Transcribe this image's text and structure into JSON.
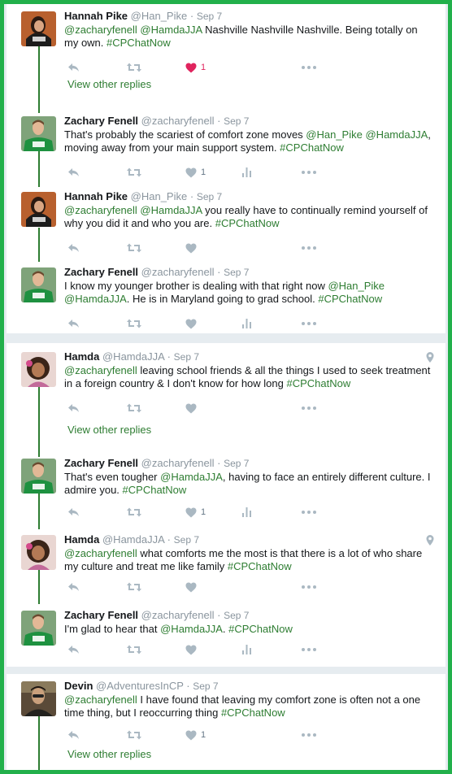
{
  "colors": {
    "accent": "#2e7d32",
    "like": "#e0245e",
    "frame": "#22b04b",
    "muted": "#8a959e"
  },
  "sep": "·",
  "groups": [
    {
      "tweets": [
        {
          "name": "Hannah Pike",
          "handle": "@Han_Pike",
          "time": "Sep 7",
          "segments": [
            [
              "@zacharyfenell",
              1
            ],
            [
              " ",
              0
            ],
            [
              "@HamdaJJA",
              1
            ],
            [
              " Nashville Nashville Nashville. Being totally on my own. ",
              0
            ],
            [
              "#CPChatNow",
              1
            ]
          ],
          "likes": "1",
          "liked": true,
          "analytics": false
        },
        {
          "name": "Zachary Fenell",
          "handle": "@zacharyfenell",
          "time": "Sep 7",
          "segments": [
            [
              "That's probably the scariest of comfort zone moves ",
              0
            ],
            [
              "@Han_Pike",
              1
            ],
            [
              " ",
              0
            ],
            [
              "@HamdaJJA",
              1
            ],
            [
              ", moving away from your main support system. ",
              0
            ],
            [
              "#CPChatNow",
              1
            ]
          ],
          "likes": "1",
          "liked": false,
          "analytics": true
        },
        {
          "name": "Hannah Pike",
          "handle": "@Han_Pike",
          "time": "Sep 7",
          "segments": [
            [
              "@zacharyfenell",
              1
            ],
            [
              " ",
              0
            ],
            [
              "@HamdaJJA",
              1
            ],
            [
              " you really have to continually remind yourself of why you did it and who you are. ",
              0
            ],
            [
              "#CPChatNow",
              1
            ]
          ],
          "likes": "",
          "liked": false,
          "analytics": false
        },
        {
          "name": "Zachary Fenell",
          "handle": "@zacharyfenell",
          "time": "Sep 7",
          "segments": [
            [
              "I know my younger brother is dealing with that right now ",
              0
            ],
            [
              "@Han_Pike",
              1
            ],
            [
              " ",
              0
            ],
            [
              "@HamdaJJA",
              1
            ],
            [
              ". He is in Maryland going to grad school. ",
              0
            ],
            [
              "#CPChatNow",
              1
            ]
          ],
          "likes": "",
          "liked": false,
          "analytics": true
        }
      ]
    },
    {
      "tweets": [
        {
          "name": "Hamda",
          "handle": "@HamdaJJA",
          "time": "Sep 7",
          "segments": [
            [
              "@zacharyfenell",
              1
            ],
            [
              " leaving school friends & all the things I used to seek treatment in a foreign country & I don't know for how long ",
              0
            ],
            [
              "#CPChatNow",
              1
            ]
          ],
          "likes": "",
          "liked": false,
          "analytics": false
        },
        {
          "name": "Zachary Fenell",
          "handle": "@zacharyfenell",
          "time": "Sep 7",
          "segments": [
            [
              "That's even tougher ",
              0
            ],
            [
              "@HamdaJJA",
              1
            ],
            [
              ", having to face an entirely different culture. I admire you. ",
              0
            ],
            [
              "#CPChatNow",
              1
            ]
          ],
          "likes": "1",
          "liked": false,
          "analytics": true
        },
        {
          "name": "Hamda",
          "handle": "@HamdaJJA",
          "time": "Sep 7",
          "segments": [
            [
              "@zacharyfenell",
              1
            ],
            [
              " what comforts me the most is that there is a lot of who share my culture and treat me like family ",
              0
            ],
            [
              "#CPChatNow",
              1
            ]
          ],
          "likes": "",
          "liked": false,
          "analytics": false
        },
        {
          "name": "Zachary Fenell",
          "handle": "@zacharyfenell",
          "time": "Sep 7",
          "segments": [
            [
              "I'm glad to hear that ",
              0
            ],
            [
              "@HamdaJJA",
              1
            ],
            [
              ". ",
              0
            ],
            [
              "#CPChatNow",
              1
            ]
          ],
          "likes": "",
          "liked": false,
          "analytics": true
        }
      ]
    },
    {
      "tweets": [
        {
          "name": "Devin",
          "handle": "@AdventuresInCP",
          "time": "Sep 7",
          "segments": [
            [
              "@zacharyfenell",
              1
            ],
            [
              " I have found that leaving my comfort zone is often not a one time thing, but I reoccurring thing ",
              0
            ],
            [
              "#CPChatNow",
              1
            ]
          ],
          "likes": "1",
          "liked": false,
          "analytics": false
        }
      ]
    }
  ],
  "view_other_replies": "View other replies"
}
